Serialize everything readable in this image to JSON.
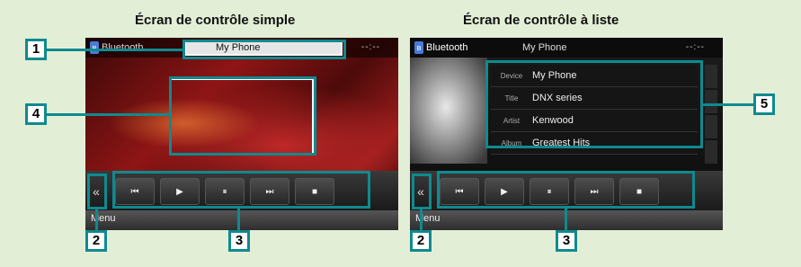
{
  "titles": {
    "simple": "Écran de contrôle simple",
    "list": "Écran de contrôle à liste"
  },
  "screen_simple": {
    "source": "Bluetooth",
    "phone": "My Phone",
    "clock": "--:--",
    "collapse_icon": "«",
    "controls": [
      "⏮",
      "▶",
      "⏸",
      "⏭",
      "■"
    ],
    "menu": "Menu"
  },
  "screen_list": {
    "source": "Bluetooth",
    "phone": "My Phone",
    "clock": "--:--",
    "info": [
      {
        "key": "Device",
        "value": "My Phone"
      },
      {
        "key": "Title",
        "value": "DNX series"
      },
      {
        "key": "Artist",
        "value": "Kenwood"
      },
      {
        "key": "Album",
        "value": "Greatest Hits"
      }
    ],
    "collapse_icon": "«",
    "controls": [
      "⏮",
      "▶",
      "⏸",
      "⏭",
      "■"
    ],
    "menu": "Menu"
  },
  "callouts": [
    "1",
    "2",
    "3",
    "4",
    "2",
    "3",
    "5"
  ],
  "colors": {
    "callout": "#0f8a8f",
    "background": "#e3eed6"
  }
}
